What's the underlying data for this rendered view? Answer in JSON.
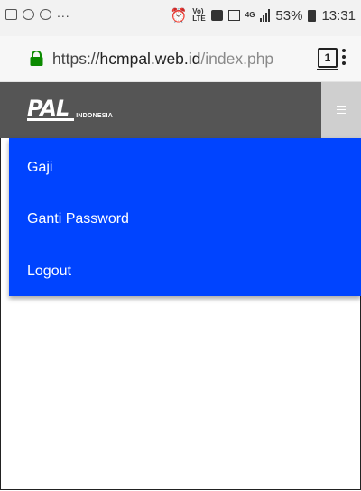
{
  "status_bar": {
    "left_icons": [
      "image-icon",
      "android-icon",
      "sync-icon"
    ],
    "ellipsis": "...",
    "volte_top": "Vo)",
    "volte_bottom": "LTE",
    "network": "4G",
    "battery_percent": "53%",
    "time": "13:31"
  },
  "browser": {
    "url_scheme": "https://",
    "url_host": "hcmpal.web.id",
    "url_path": "/index.php",
    "tab_count": "1"
  },
  "navbar": {
    "logo_mark": "PAL",
    "logo_sub": "INDONESIA",
    "bg_color": "#555555"
  },
  "menu": {
    "bg_color": "#0044ff",
    "items": [
      {
        "label": "Gaji"
      },
      {
        "label": "Ganti Password"
      },
      {
        "label": "Logout"
      }
    ]
  }
}
